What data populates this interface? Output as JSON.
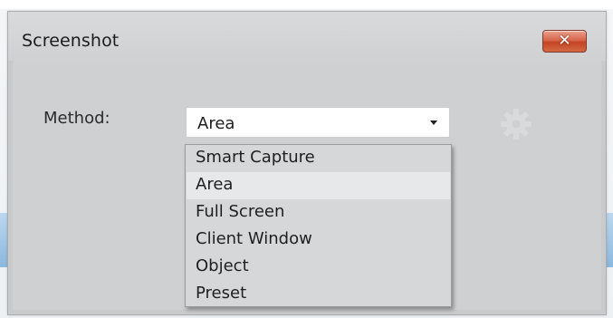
{
  "window": {
    "title": "Screenshot",
    "close_label": "✕"
  },
  "form": {
    "method_label": "Method:",
    "method_value": "Area"
  },
  "dropdown": {
    "options": [
      {
        "label": "Smart Capture",
        "selected": false
      },
      {
        "label": "Area",
        "selected": true
      },
      {
        "label": "Full Screen",
        "selected": false
      },
      {
        "label": "Client Window",
        "selected": false
      },
      {
        "label": "Object",
        "selected": false
      },
      {
        "label": "Preset",
        "selected": false
      }
    ]
  },
  "icons": {
    "close": "close-icon",
    "dropdown_arrow": "chevron-down-icon",
    "settings": "gear-icon"
  },
  "colors": {
    "window_bg": "#c9cacb",
    "close_button": "#c44324",
    "selected_item_bg": "#e7e8e9"
  }
}
